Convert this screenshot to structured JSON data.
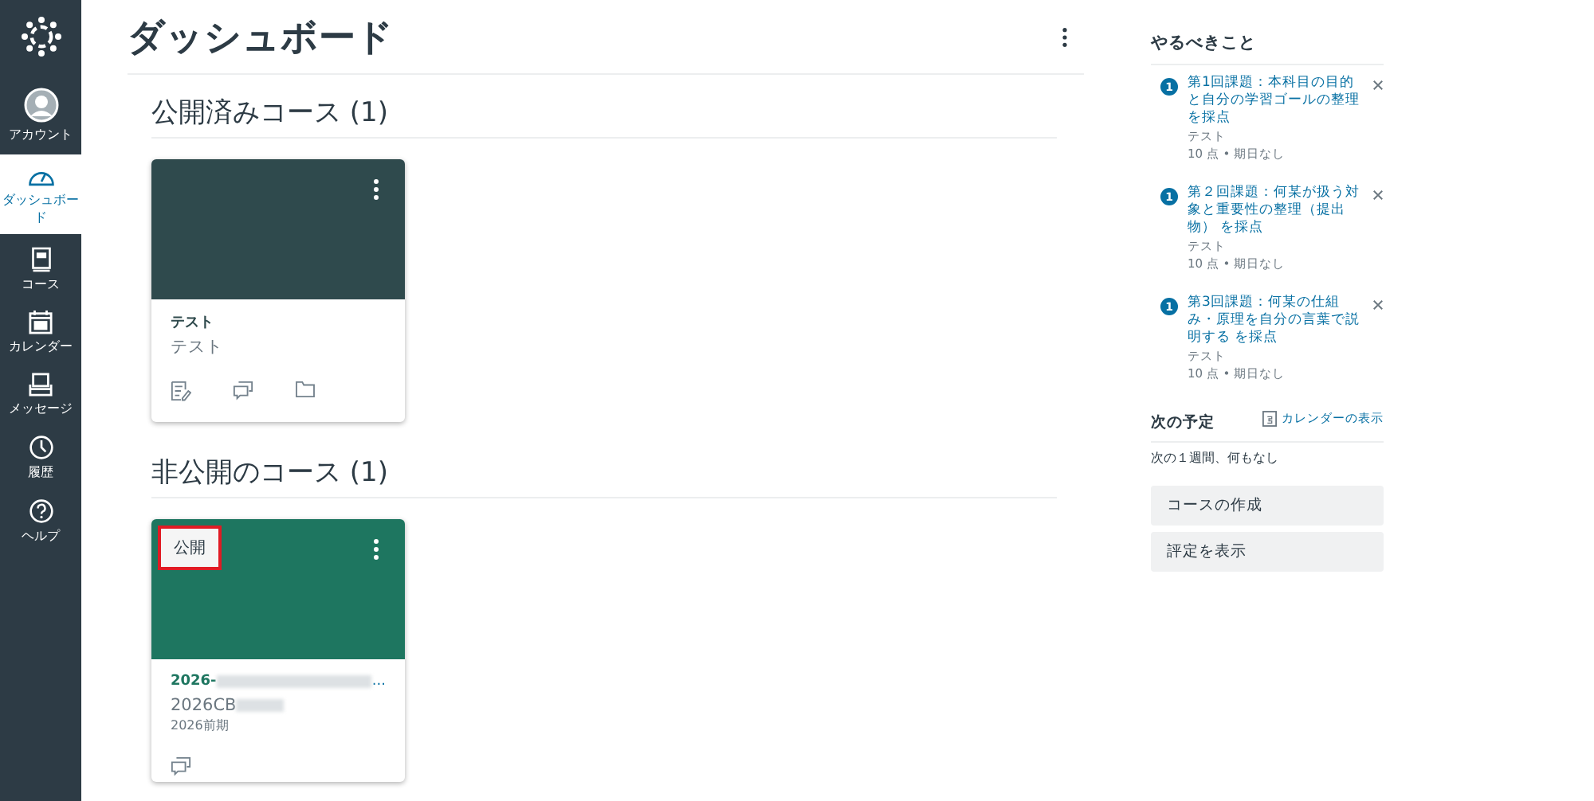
{
  "nav": [
    {
      "kind": "account",
      "label": "アカウント",
      "selected": false
    },
    {
      "kind": "dashboard",
      "label": "ダッシュボード",
      "selected": true
    },
    {
      "kind": "courses",
      "label": "コース",
      "selected": false
    },
    {
      "kind": "calendar",
      "label": "カレンダー",
      "selected": false
    },
    {
      "kind": "inbox",
      "label": "メッセージ",
      "selected": false
    },
    {
      "kind": "history",
      "label": "履歴",
      "selected": false
    },
    {
      "kind": "help",
      "label": "ヘルプ",
      "selected": false
    }
  ],
  "page_title": "ダッシュボード",
  "sections": [
    {
      "heading": "公開済みコース (1)",
      "cards": [
        {
          "color": "#2f4a4d",
          "title_prefix": "テスト",
          "code": "テスト",
          "icons": [
            {
              "kind": "assignments"
            },
            {
              "kind": "discussions"
            },
            {
              "kind": "files"
            }
          ]
        }
      ]
    },
    {
      "heading": "非公開のコース (1)",
      "cards": [
        {
          "color": "#1e7660",
          "badge": "公開",
          "highlighted": true,
          "title_prefix": "2026-",
          "title_redacted": true,
          "title_suffix": "...",
          "code": "2026CB",
          "code_redacted": true,
          "term": "2026前期",
          "icons": [
            {
              "kind": "discussions"
            }
          ]
        }
      ]
    }
  ],
  "todo": {
    "heading": "やるべきこと",
    "items": [
      {
        "count": "1",
        "title": "第1回課題：本科目の目的と自分の学習ゴールの整理を採点",
        "course": "テスト",
        "meta": "10 点 • 期日なし"
      },
      {
        "count": "1",
        "title": "第２回課題：何某が扱う対象と重要性の整理（提出物） を採点",
        "course": "テスト",
        "meta": "10 点 • 期日なし"
      },
      {
        "count": "1",
        "title": "第3回課題：何某の仕組み・原理を自分の言葉で説明する を採点",
        "course": "テスト",
        "meta": "10 点 • 期日なし"
      }
    ]
  },
  "upcoming": {
    "heading": "次の予定",
    "calendar_link": "カレンダーの表示",
    "empty": "次の１週間、何もなし"
  },
  "buttons": [
    "コースの作成",
    "評定を表示"
  ]
}
